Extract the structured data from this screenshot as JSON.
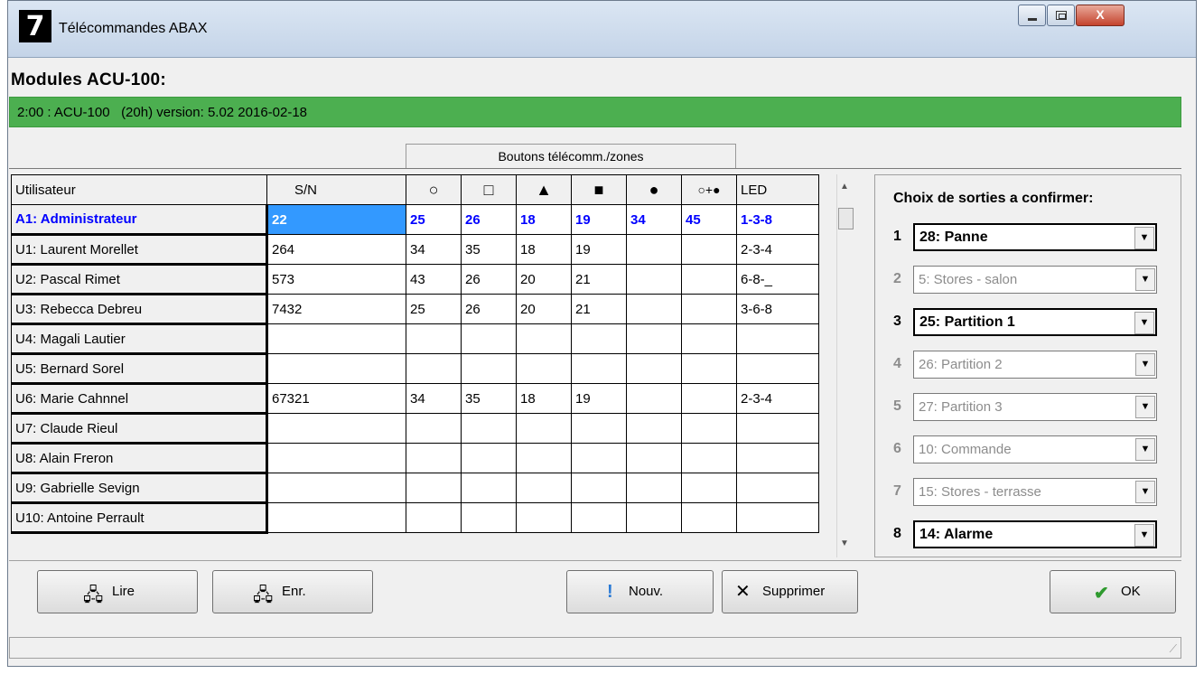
{
  "window": {
    "icon": "7",
    "title": "Télécommandes ABAX"
  },
  "modules_label": "Modules ACU-100:",
  "module_info": "2:00 : ACU-100   (20h) version: 5.02 2016-02-18",
  "group_header": "Boutons télécomm./zones",
  "columns": {
    "user": "Utilisateur",
    "sn": "S/N",
    "b1": "○",
    "b2": "□",
    "b3": "▲",
    "b4": "■",
    "b5": "●",
    "b6": "○+●",
    "led": "LED"
  },
  "rows": [
    {
      "user": "A1: Administrateur",
      "sn": "22",
      "b1": "25",
      "b2": "26",
      "b3": "18",
      "b4": "19",
      "b5": "34",
      "b6": "45",
      "led": "1-3-8"
    },
    {
      "user": "U1: Laurent Morellet",
      "sn": "264",
      "b1": "34",
      "b2": "35",
      "b3": "18",
      "b4": "19",
      "b5": "",
      "b6": "",
      "led": "2-3-4"
    },
    {
      "user": "U2: Pascal Rimet",
      "sn": "573",
      "b1": "43",
      "b2": "26",
      "b3": "20",
      "b4": "21",
      "b5": "",
      "b6": "",
      "led": "6-8-_"
    },
    {
      "user": "U3: Rebecca Debreu",
      "sn": "7432",
      "b1": "25",
      "b2": "26",
      "b3": "20",
      "b4": "21",
      "b5": "",
      "b6": "",
      "led": "3-6-8"
    },
    {
      "user": "U4: Magali Lautier",
      "sn": "",
      "b1": "",
      "b2": "",
      "b3": "",
      "b4": "",
      "b5": "",
      "b6": "",
      "led": ""
    },
    {
      "user": "U5: Bernard Sorel",
      "sn": "",
      "b1": "",
      "b2": "",
      "b3": "",
      "b4": "",
      "b5": "",
      "b6": "",
      "led": ""
    },
    {
      "user": "U6: Marie Cahnnel",
      "sn": "67321",
      "b1": "34",
      "b2": "35",
      "b3": "18",
      "b4": "19",
      "b5": "",
      "b6": "",
      "led": "2-3-4"
    },
    {
      "user": "U7: Claude Rieul",
      "sn": "",
      "b1": "",
      "b2": "",
      "b3": "",
      "b4": "",
      "b5": "",
      "b6": "",
      "led": ""
    },
    {
      "user": "U8: Alain Freron",
      "sn": "",
      "b1": "",
      "b2": "",
      "b3": "",
      "b4": "",
      "b5": "",
      "b6": "",
      "led": ""
    },
    {
      "user": "U9: Gabrielle Sevign",
      "sn": "",
      "b1": "",
      "b2": "",
      "b3": "",
      "b4": "",
      "b5": "",
      "b6": "",
      "led": ""
    },
    {
      "user": "U10: Antoine Perrault",
      "sn": "",
      "b1": "",
      "b2": "",
      "b3": "",
      "b4": "",
      "b5": "",
      "b6": "",
      "led": ""
    }
  ],
  "outputs_title": "Choix de sorties a confirmer:",
  "outputs": [
    {
      "num": "1",
      "value": "28: Panne",
      "active": true
    },
    {
      "num": "2",
      "value": "5: Stores - salon",
      "active": false
    },
    {
      "num": "3",
      "value": "25: Partition 1",
      "active": true
    },
    {
      "num": "4",
      "value": "26: Partition 2",
      "active": false
    },
    {
      "num": "5",
      "value": "27: Partition 3",
      "active": false
    },
    {
      "num": "6",
      "value": "10: Commande",
      "active": false
    },
    {
      "num": "7",
      "value": "15: Stores - terrasse",
      "active": false
    },
    {
      "num": "8",
      "value": "14: Alarme",
      "active": true
    }
  ],
  "buttons": {
    "read": "Lire",
    "write": "Enr.",
    "new": "Nouv.",
    "delete": "Supprimer",
    "ok": "OK"
  },
  "colors": {
    "module_bar": "#4caf50",
    "admin_text": "#0000ff",
    "selection": "#3399ff"
  }
}
